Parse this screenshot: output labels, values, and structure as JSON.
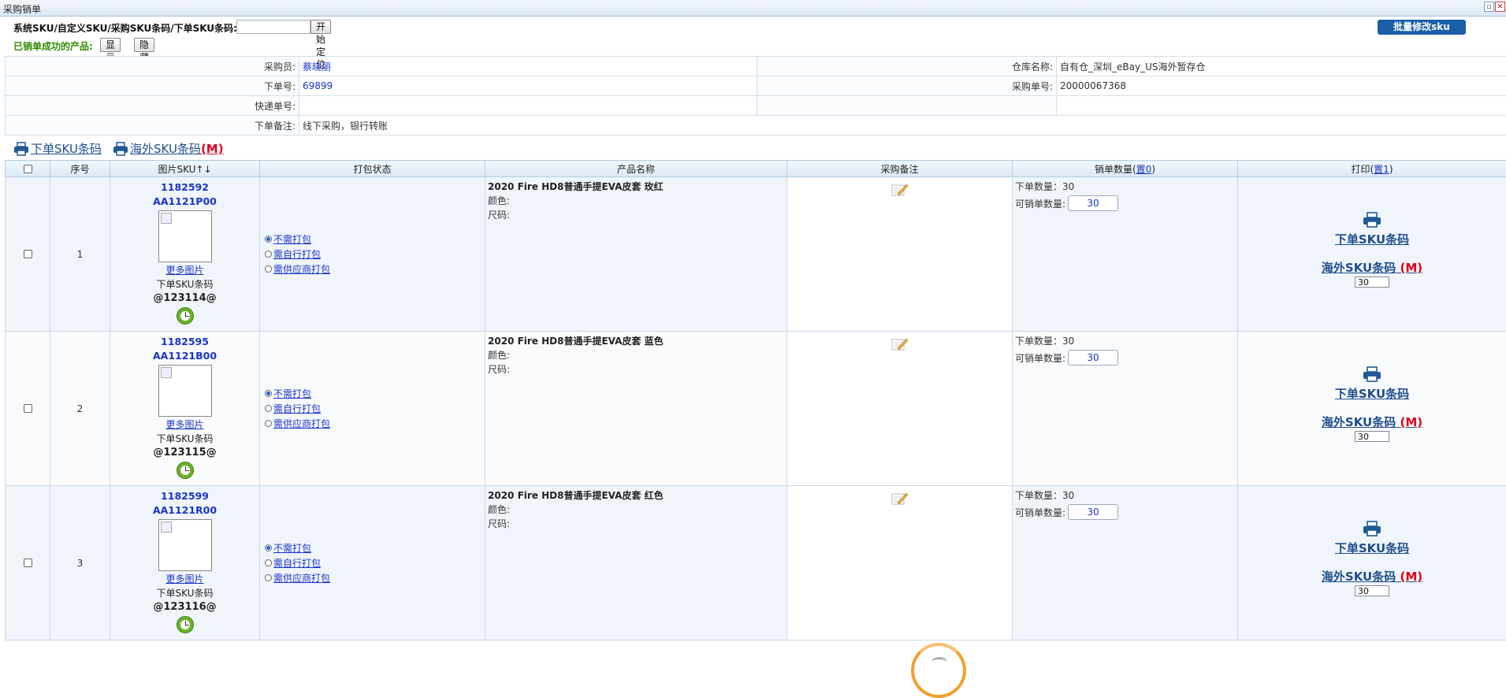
{
  "window": {
    "title": "采购销单",
    "restore_icon": "restore-icon",
    "close_icon": "close-icon"
  },
  "search": {
    "label": "系统SKU/自定义SKU/采购SKU条码/下单SKU条码:",
    "input_value": "",
    "locate_button": "开始定位"
  },
  "success": {
    "label": "已销单成功的产品:",
    "show_button": "显示",
    "hide_button": "隐藏"
  },
  "batch_button": "批量修改sku",
  "info": {
    "buyer_label": "采购员:",
    "buyer_value": "蔡晓丽",
    "warehouse_label": "仓库名称:",
    "warehouse_value": "自有仓_深圳_eBay_US海外暂存仓",
    "order_label": "下单号:",
    "order_value": "69899",
    "purchase_label": "采购单号:",
    "purchase_value": "20000067368",
    "tracking_label": "快递单号:",
    "tracking_value": "",
    "remark_label": "下单备注:",
    "remark_value": "线下采购，银行转账"
  },
  "print_links": {
    "order_sku": "下单SKU条码",
    "overseas_sku": "海外SKU条码",
    "overseas_m": "(M)"
  },
  "columns": {
    "seq": "序号",
    "sku": "图片SKU↑↓",
    "pack": "打包状态",
    "product": "产品名称",
    "note": "采购备注",
    "qty_prefix": "销单数量(",
    "qty_link": "置0",
    "qty_suffix": ")",
    "print_prefix": "打印(",
    "print_link": "置1",
    "print_suffix": ")"
  },
  "pack_options": [
    "不需打包",
    "需自行打包",
    "需供应商打包"
  ],
  "rows": [
    {
      "seq": "1",
      "sku_id": "1182592",
      "sku_code": "AA1121P00",
      "more": "更多图片",
      "barcode_label": "下单SKU条码",
      "code": "@123114@",
      "product_name": "2020 Fire HD8普通手提EVA皮套 玫红",
      "color_label": "颜色:",
      "size_label": "尺码:",
      "order_qty_label": "下单数量：30",
      "sale_qty_label": "可销单数量:",
      "sale_qty": "30",
      "print_order": "下单SKU条码",
      "print_overseas": "海外SKU条码",
      "print_m": "(M)",
      "print_count": "30"
    },
    {
      "seq": "2",
      "sku_id": "1182595",
      "sku_code": "AA1121B00",
      "more": "更多图片",
      "barcode_label": "下单SKU条码",
      "code": "@123115@",
      "product_name": "2020 Fire HD8普通手提EVA皮套 蓝色",
      "color_label": "颜色:",
      "size_label": "尺码:",
      "order_qty_label": "下单数量：30",
      "sale_qty_label": "可销单数量:",
      "sale_qty": "30",
      "print_order": "下单SKU条码",
      "print_overseas": "海外SKU条码",
      "print_m": "(M)",
      "print_count": "30"
    },
    {
      "seq": "3",
      "sku_id": "1182599",
      "sku_code": "AA1121R00",
      "more": "更多图片",
      "barcode_label": "下单SKU条码",
      "code": "@123116@",
      "product_name": "2020 Fire HD8普通手提EVA皮套 红色",
      "color_label": "颜色:",
      "size_label": "尺码:",
      "order_qty_label": "下单数量：30",
      "sale_qty_label": "可销单数量:",
      "sale_qty": "30",
      "print_order": "下单SKU条码",
      "print_overseas": "海外SKU条码",
      "print_m": "(M)",
      "print_count": "30"
    }
  ]
}
